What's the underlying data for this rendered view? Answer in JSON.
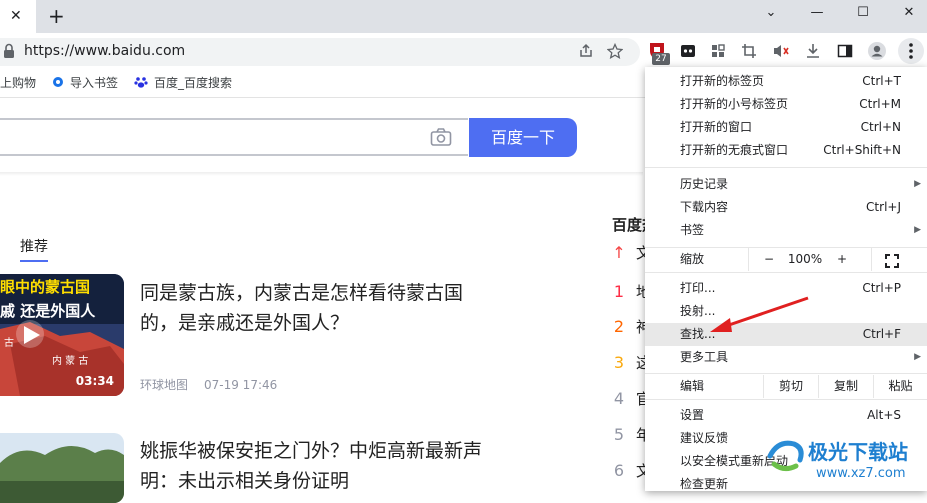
{
  "browser": {
    "tab_close": "✕",
    "new_tab": "+",
    "url": "https://www.baidu.com",
    "extension_badge": "27",
    "window_controls": [
      "⌄",
      "—",
      "☐",
      "✕"
    ]
  },
  "bookmarks": {
    "items": [
      "上购物",
      "导入书签",
      "百度_百度搜索"
    ]
  },
  "page": {
    "search_button": "百度一下",
    "feed_tab": "推荐",
    "news": [
      {
        "title": "同是蒙古族，内蒙古是怎样看待蒙古国的，是亲戚还是外国人？",
        "source": "环球地图",
        "time": "07-19 17:46",
        "thumb_caption_1": "眼中的蒙古国",
        "thumb_caption_2": "戚 还是外国人",
        "thumb_map_label_1": "古",
        "thumb_map_label_2": "内 蒙 古",
        "duration": "03:34"
      },
      {
        "title": "姚振华被保安拒之门外？中炬高新最新声明：未出示相关身份证明"
      }
    ],
    "hot": {
      "heading": "百度热",
      "items": [
        {
          "num": "↑",
          "text": "文",
          "color": "#f54545"
        },
        {
          "num": "1",
          "text": "地",
          "color": "#fe2d46"
        },
        {
          "num": "2",
          "text": "神",
          "color": "#f60"
        },
        {
          "num": "3",
          "text": "这",
          "color": "#faa90e"
        },
        {
          "num": "4",
          "text": "官",
          "color": "#9195a3"
        },
        {
          "num": "5",
          "text": "年",
          "color": "#9195a3"
        },
        {
          "num": "6",
          "text": "文",
          "color": "#9195a3"
        }
      ]
    }
  },
  "menu": {
    "new_tab": {
      "label": "打开新的标签页",
      "shortcut": "Ctrl+T"
    },
    "new_tab_group": {
      "label": "打开新的小号标签页",
      "shortcut": "Ctrl+M"
    },
    "new_window": {
      "label": "打开新的窗口",
      "shortcut": "Ctrl+N"
    },
    "new_incognito": {
      "label": "打开新的无痕式窗口",
      "shortcut": "Ctrl+Shift+N"
    },
    "history": {
      "label": "历史记录"
    },
    "downloads": {
      "label": "下载内容",
      "shortcut": "Ctrl+J"
    },
    "bookmarks": {
      "label": "书签"
    },
    "zoom": {
      "label": "缩放",
      "minus": "−",
      "value": "100%",
      "plus": "+"
    },
    "print": {
      "label": "打印...",
      "shortcut": "Ctrl+P"
    },
    "cast": {
      "label": "投射..."
    },
    "find": {
      "label": "查找...",
      "shortcut": "Ctrl+F"
    },
    "more_tools": {
      "label": "更多工具"
    },
    "edit": {
      "label": "编辑",
      "cut": "剪切",
      "copy": "复制",
      "paste": "粘贴"
    },
    "settings": {
      "label": "设置",
      "shortcut": "Alt+S"
    },
    "feedback": {
      "label": "建议反馈"
    },
    "safe_restart": {
      "label": "以安全模式重新启动"
    },
    "check_update": {
      "label": "检查更新"
    }
  },
  "watermark": {
    "text_cn": "极光下载站",
    "text_url": "www.xz7.com"
  },
  "colors": {
    "accent": "#4e6ef2",
    "arrow_red": "#e02020"
  }
}
